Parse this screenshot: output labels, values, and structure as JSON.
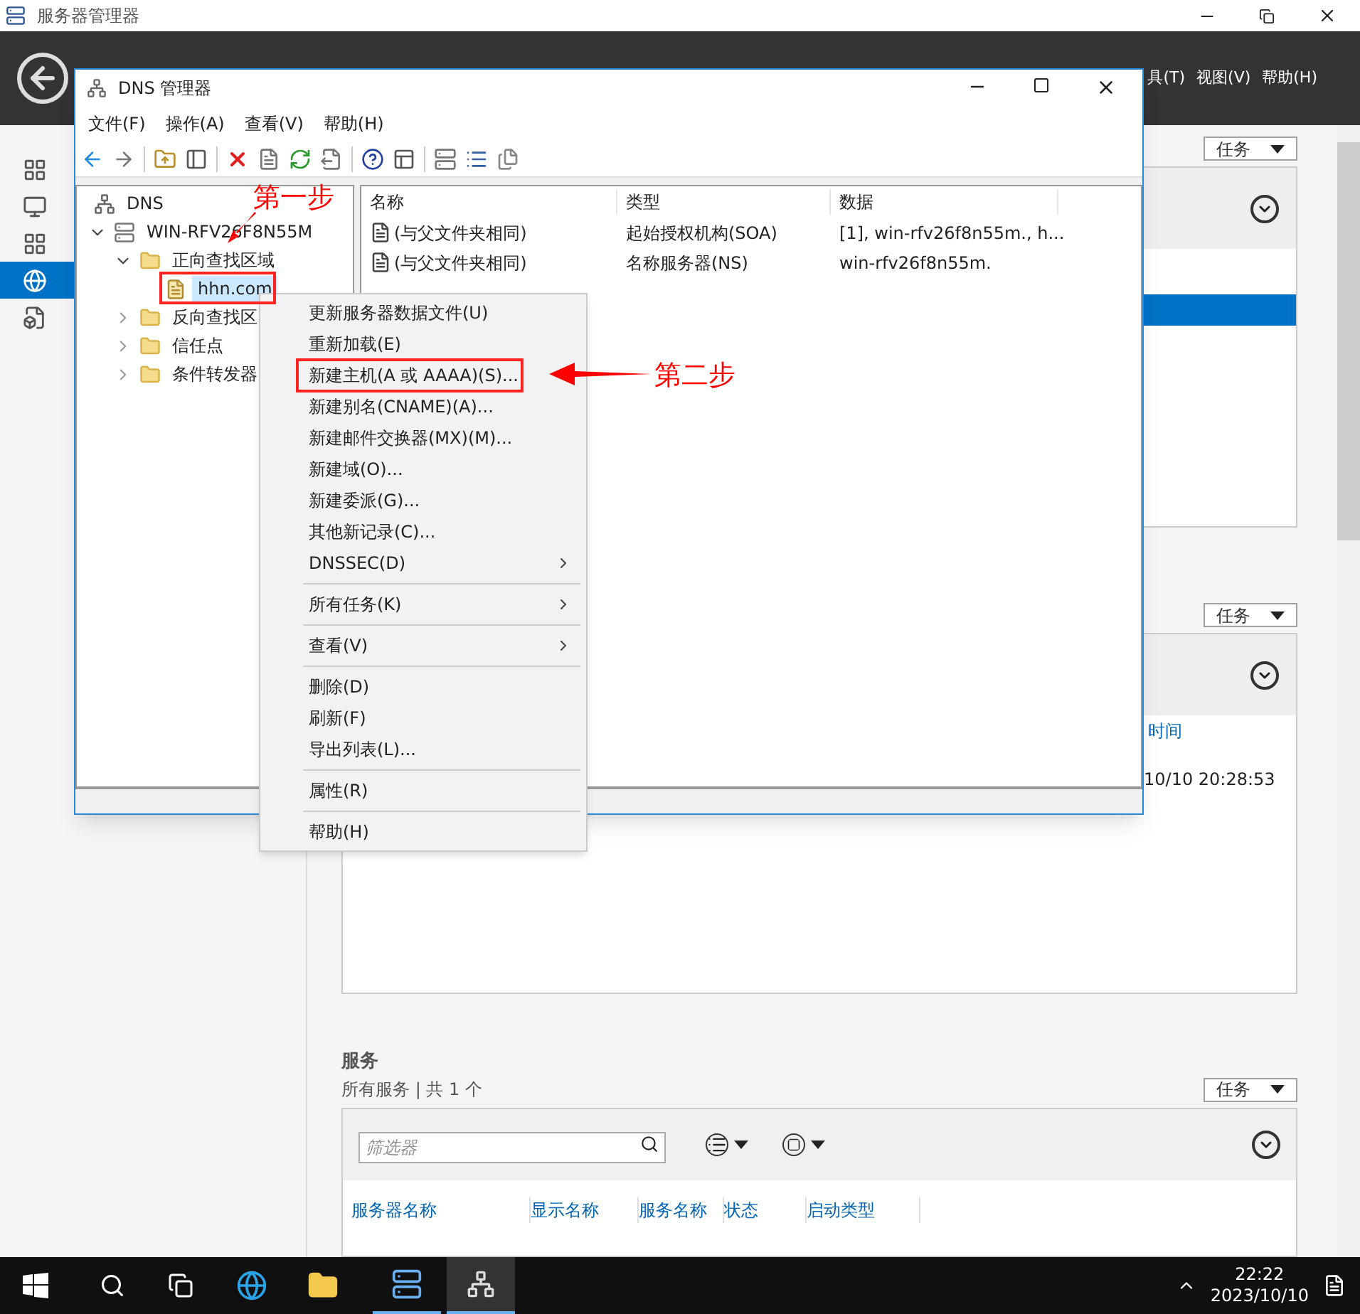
{
  "server_manager": {
    "title": "服务器管理器",
    "menu": [
      "具(T)",
      "视图(V)",
      "帮助(H)"
    ],
    "sidebar": [
      {
        "selected": false
      },
      {
        "selected": false
      },
      {
        "selected": false
      },
      {
        "selected": true
      },
      {
        "selected": false
      }
    ],
    "events_panel": {
      "task_button": "任务",
      "time_header": "时间",
      "time_cell": "10/10 20:28:53"
    },
    "top_panel": {
      "task_button": "任务"
    },
    "services": {
      "title": "服务",
      "subtitle": "所有服务 | 共 1 个",
      "task_button": "任务",
      "filter_placeholder": "筛选器",
      "columns": [
        "服务器名称",
        "显示名称",
        "服务名称",
        "状态",
        "启动类型"
      ]
    }
  },
  "dns_window": {
    "title": "DNS 管理器",
    "menu": [
      "文件(F)",
      "操作(A)",
      "查看(V)",
      "帮助(H)"
    ],
    "tree": [
      {
        "label": "DNS",
        "children": [
          {
            "label": "WIN-RFV26F8N55M",
            "expanded": true,
            "children": [
              {
                "label": "正向查找区域",
                "expanded": true,
                "children": [
                  {
                    "label": "hhn.com",
                    "selected": true
                  }
                ]
              },
              {
                "label": "反向查找区",
                "expanded": false
              },
              {
                "label": "信任点",
                "expanded": false
              },
              {
                "label": "条件转发器",
                "expanded": false
              }
            ]
          }
        ]
      }
    ],
    "list_columns": [
      "名称",
      "类型",
      "数据"
    ],
    "list_rows": [
      [
        "(与父文件夹相同)",
        "起始授权机构(SOA)",
        "[1], win-rfv26f8n55m., h..."
      ],
      [
        "(与父文件夹相同)",
        "名称服务器(NS)",
        "win-rfv26f8n55m."
      ]
    ]
  },
  "context_menu": [
    {
      "kind": "item",
      "label": "更新服务器数据文件(U)",
      "submenu": false
    },
    {
      "kind": "item",
      "label": "重新加载(E)",
      "submenu": false
    },
    {
      "kind": "item",
      "label": "新建主机(A 或 AAAA)(S)...",
      "submenu": false
    },
    {
      "kind": "item",
      "label": "新建别名(CNAME)(A)...",
      "submenu": false
    },
    {
      "kind": "item",
      "label": "新建邮件交换器(MX)(M)...",
      "submenu": false
    },
    {
      "kind": "item",
      "label": "新建域(O)...",
      "submenu": false
    },
    {
      "kind": "item",
      "label": "新建委派(G)...",
      "submenu": false
    },
    {
      "kind": "item",
      "label": "其他新记录(C)...",
      "submenu": false
    },
    {
      "kind": "item",
      "label": "DNSSEC(D)",
      "submenu": true
    },
    {
      "kind": "separator"
    },
    {
      "kind": "item",
      "label": "所有任务(K)",
      "submenu": true
    },
    {
      "kind": "separator"
    },
    {
      "kind": "item",
      "label": "查看(V)",
      "submenu": true
    },
    {
      "kind": "separator"
    },
    {
      "kind": "item",
      "label": "删除(D)",
      "submenu": false
    },
    {
      "kind": "item",
      "label": "刷新(F)",
      "submenu": false
    },
    {
      "kind": "item",
      "label": "导出列表(L)...",
      "submenu": false
    },
    {
      "kind": "separator"
    },
    {
      "kind": "item",
      "label": "属性(R)",
      "submenu": false
    },
    {
      "kind": "separator"
    },
    {
      "kind": "item",
      "label": "帮助(H)",
      "submenu": false
    }
  ],
  "annotations": [
    "第一步",
    "第二步"
  ],
  "taskbar": {
    "time": "22:22",
    "date": "2023/10/10"
  }
}
